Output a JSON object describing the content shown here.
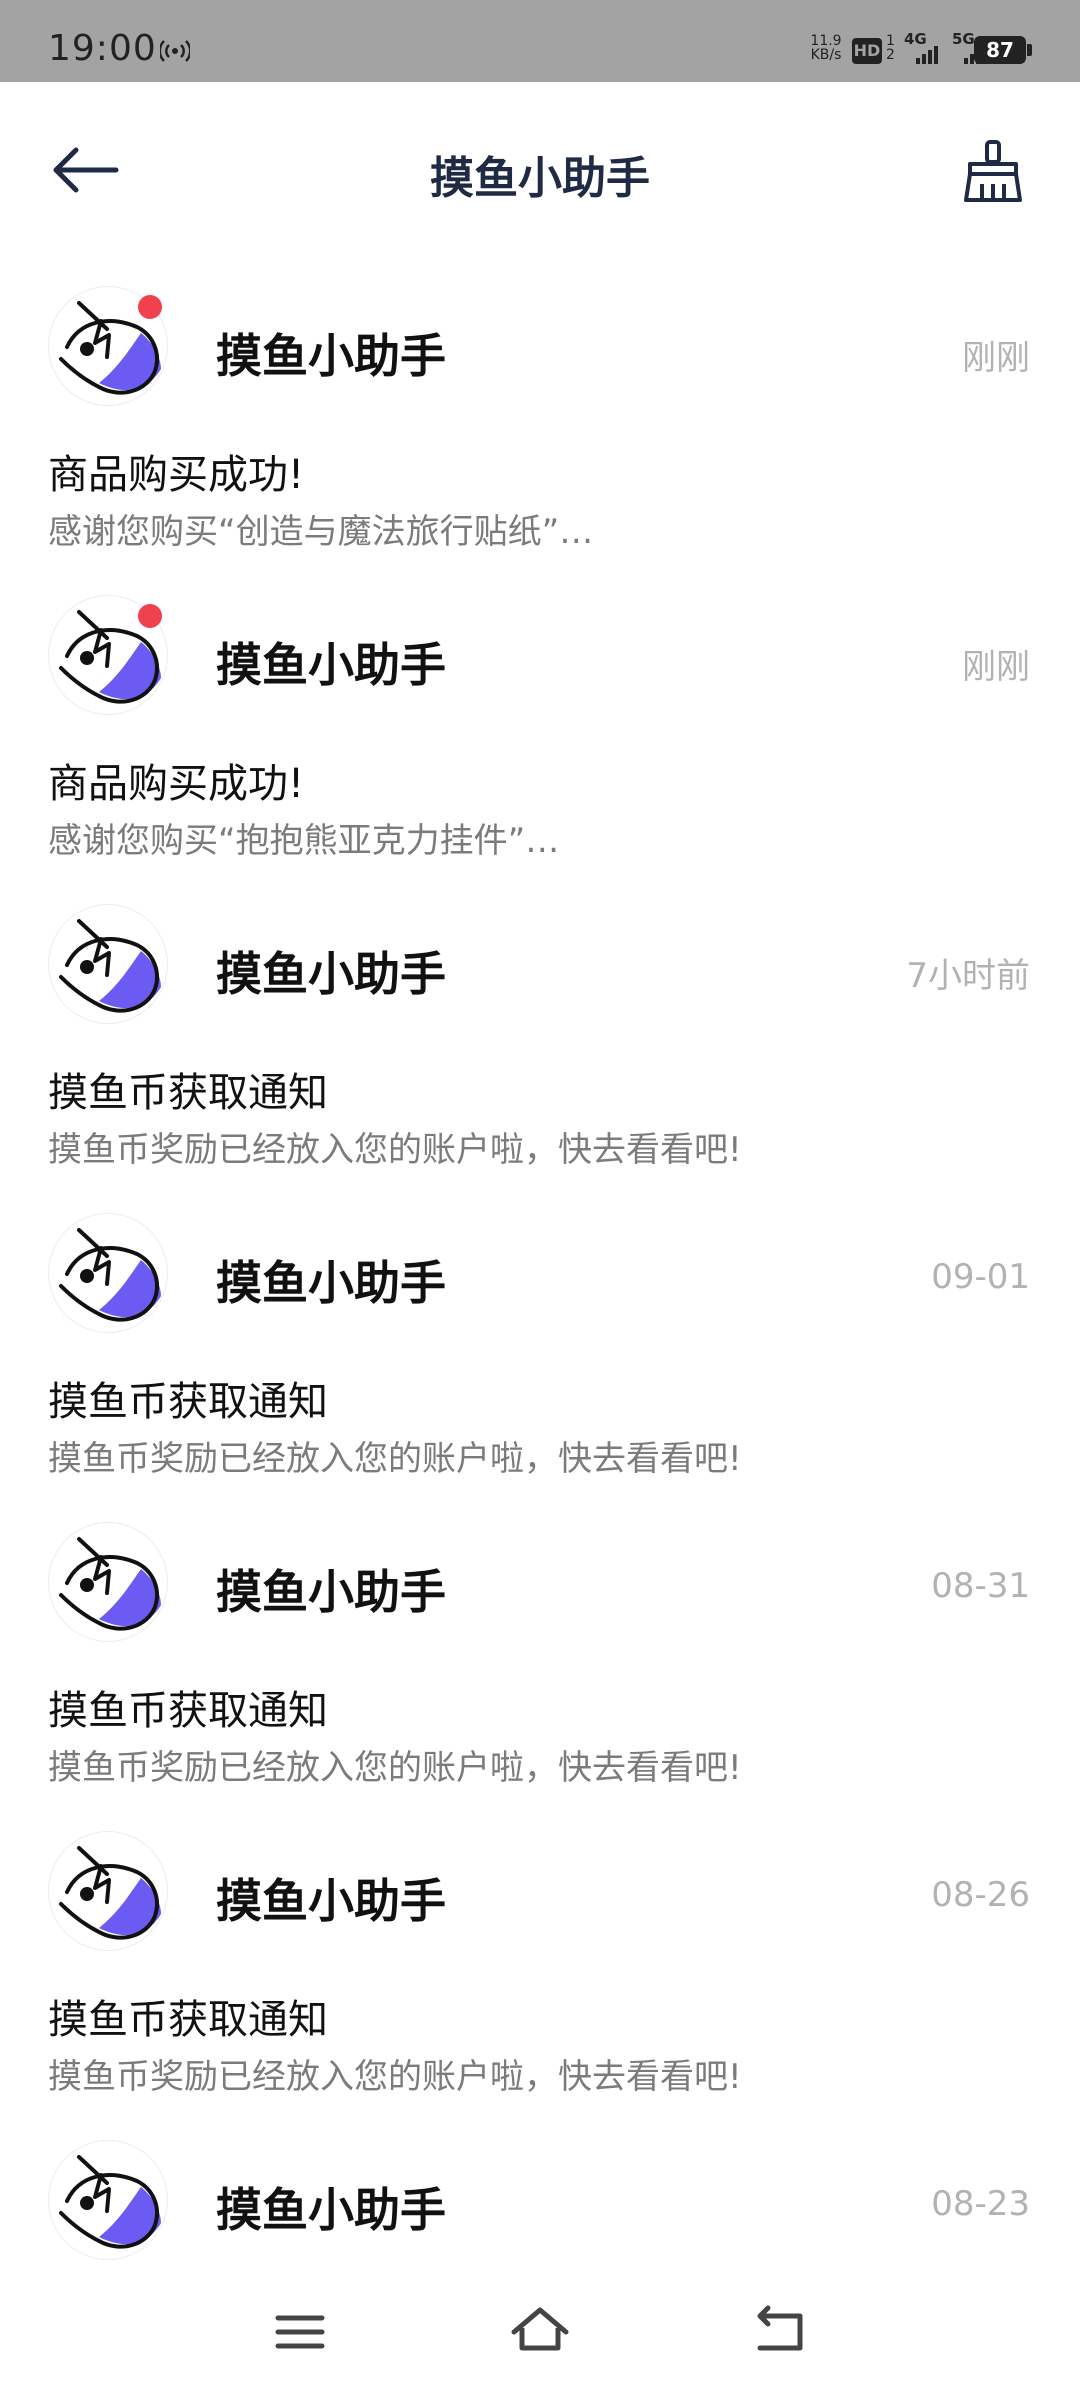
{
  "status_bar": {
    "time": "19:00",
    "net_speed_value": "11.9",
    "net_speed_unit": "KB/s",
    "hd_label": "HD",
    "sim_top": "1",
    "sim_bottom": "2",
    "net_1": "4G",
    "net_2": "5G",
    "battery": "87"
  },
  "header": {
    "title": "摸鱼小助手",
    "back_icon": "arrow-left-icon",
    "action_icon": "broom-icon"
  },
  "messages": [
    {
      "sender": "摸鱼小助手",
      "time": "刚刚",
      "title": "商品购买成功!",
      "preview": "感谢您购买“创造与魔法旅行贴纸”…",
      "unread": true
    },
    {
      "sender": "摸鱼小助手",
      "time": "刚刚",
      "title": "商品购买成功!",
      "preview": "感谢您购买“抱抱熊亚克力挂件”…",
      "unread": true
    },
    {
      "sender": "摸鱼小助手",
      "time": "7小时前",
      "title": "摸鱼币获取通知",
      "preview": "摸鱼币奖励已经放入您的账户啦，快去看看吧!",
      "unread": false
    },
    {
      "sender": "摸鱼小助手",
      "time": "09-01",
      "title": "摸鱼币获取通知",
      "preview": "摸鱼币奖励已经放入您的账户啦，快去看看吧!",
      "unread": false
    },
    {
      "sender": "摸鱼小助手",
      "time": "08-31",
      "title": "摸鱼币获取通知",
      "preview": "摸鱼币奖励已经放入您的账户啦，快去看看吧!",
      "unread": false
    },
    {
      "sender": "摸鱼小助手",
      "time": "08-26",
      "title": "摸鱼币获取通知",
      "preview": "摸鱼币奖励已经放入您的账户啦，快去看看吧!",
      "unread": false
    },
    {
      "sender": "摸鱼小助手",
      "time": "08-23",
      "title": "",
      "preview": "",
      "unread": false
    }
  ],
  "colors": {
    "accent": "#6b5bf2",
    "unread_dot": "#f0414f",
    "title_text": "#1f2a44",
    "secondary_text": "#7b7b7b",
    "time_text": "#b2b2b2",
    "status_bar": "#a3a3a3"
  },
  "nav_bar": {
    "icons": [
      "menu-icon",
      "home-icon",
      "back-icon"
    ]
  }
}
